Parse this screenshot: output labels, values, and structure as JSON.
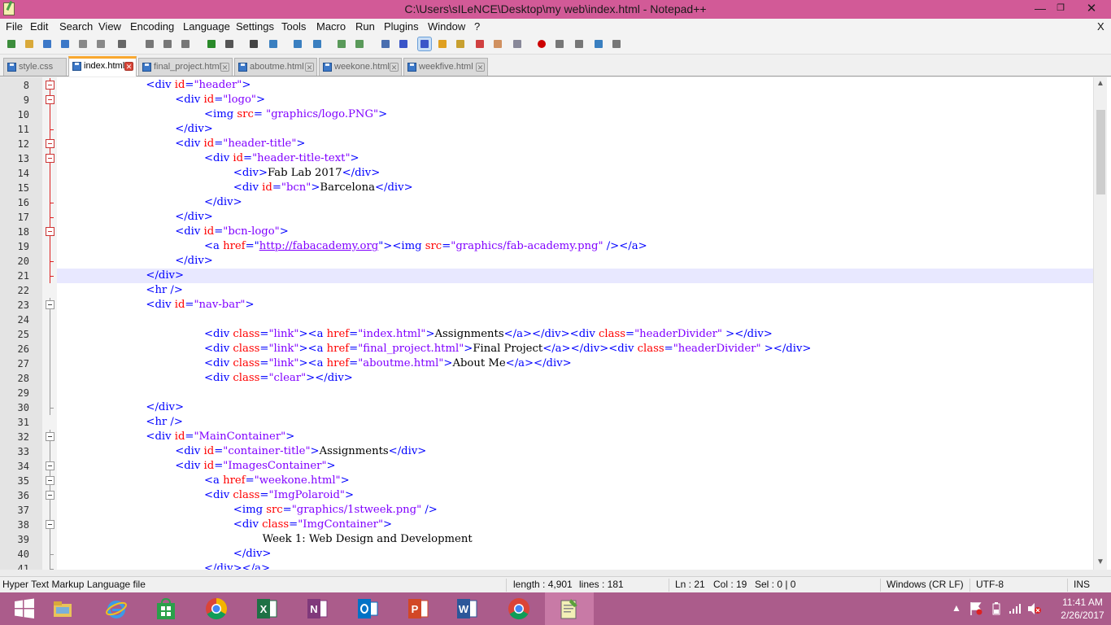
{
  "window": {
    "title": "C:\\Users\\sILeNCE\\Desktop\\my web\\index.html - Notepad++"
  },
  "menubar": {
    "items": [
      "File",
      "Edit",
      "Search",
      "View",
      "Encoding",
      "Language",
      "Settings",
      "Tools",
      "Macro",
      "Run",
      "Plugins",
      "Window",
      "?"
    ],
    "close": "X"
  },
  "toolbar": {
    "icons": [
      "new-file-icon",
      "open-file-icon",
      "save-icon",
      "save-all-icon",
      "close-icon",
      "close-all-icon",
      "print-icon",
      "cut-icon",
      "copy-icon",
      "paste-icon",
      "undo-icon",
      "redo-icon",
      "find-icon",
      "replace-icon",
      "zoom-in-icon",
      "zoom-out-icon",
      "sync-vertical-icon",
      "sync-horizontal-icon",
      "word-wrap-icon",
      "show-all-characters-icon",
      "indent-guide-icon",
      "user-defined-language-icon",
      "document-map-icon",
      "function-list-icon",
      "folder-workspace-icon",
      "monitoring-icon",
      "record-macro-icon",
      "stop-macro-icon",
      "play-macro-icon",
      "run-macro-multiple-icon",
      "save-macro-icon"
    ]
  },
  "tabs": [
    {
      "label": "style.css",
      "active": false
    },
    {
      "label": "index.html",
      "active": true
    },
    {
      "label": "final_project.html",
      "active": false
    },
    {
      "label": "aboutme.html",
      "active": false
    },
    {
      "label": "weekone.html",
      "active": false
    },
    {
      "label": "weekfive.html",
      "active": false
    }
  ],
  "editor": {
    "current_line": 21,
    "lines": [
      {
        "n": 8,
        "indent": 3,
        "tokens": [
          [
            "t",
            "<div "
          ],
          [
            "a",
            "id"
          ],
          [
            "t",
            "="
          ],
          [
            "v",
            "\"header\""
          ],
          [
            "t",
            ">"
          ]
        ],
        "fold": "open-red"
      },
      {
        "n": 9,
        "indent": 4,
        "tokens": [
          [
            "t",
            "<div "
          ],
          [
            "a",
            "id"
          ],
          [
            "t",
            "="
          ],
          [
            "v",
            "\"logo\""
          ],
          [
            "t",
            ">"
          ]
        ],
        "fold": "open-red"
      },
      {
        "n": 10,
        "indent": 5,
        "tokens": [
          [
            "t",
            "<img "
          ],
          [
            "a",
            "src"
          ],
          [
            "t",
            "= "
          ],
          [
            "v",
            "\"graphics/logo.PNG\""
          ],
          [
            "t",
            ">"
          ]
        ],
        "fold": "line"
      },
      {
        "n": 11,
        "indent": 4,
        "tokens": [
          [
            "t",
            "</div>"
          ]
        ],
        "fold": "end"
      },
      {
        "n": 12,
        "indent": 4,
        "tokens": [
          [
            "t",
            "<div "
          ],
          [
            "a",
            "id"
          ],
          [
            "t",
            "="
          ],
          [
            "v",
            "\"header-title\""
          ],
          [
            "t",
            ">"
          ]
        ],
        "fold": "open-red"
      },
      {
        "n": 13,
        "indent": 5,
        "tokens": [
          [
            "t",
            "<div "
          ],
          [
            "a",
            "id"
          ],
          [
            "t",
            "="
          ],
          [
            "v",
            "\"header-title-text\""
          ],
          [
            "t",
            ">"
          ]
        ],
        "fold": "open-red"
      },
      {
        "n": 14,
        "indent": 6,
        "tokens": [
          [
            "t",
            "<div>"
          ],
          [
            "x",
            "Fab Lab 2017"
          ],
          [
            "t",
            "</div>"
          ]
        ],
        "fold": "line"
      },
      {
        "n": 15,
        "indent": 6,
        "tokens": [
          [
            "t",
            "<div "
          ],
          [
            "a",
            "id"
          ],
          [
            "t",
            "="
          ],
          [
            "v",
            "\"bcn\""
          ],
          [
            "t",
            ">"
          ],
          [
            "x",
            "Barcelona"
          ],
          [
            "t",
            "</div>"
          ]
        ],
        "fold": "line"
      },
      {
        "n": 16,
        "indent": 5,
        "tokens": [
          [
            "t",
            "</div>"
          ]
        ],
        "fold": "end"
      },
      {
        "n": 17,
        "indent": 4,
        "tokens": [
          [
            "t",
            "</div>"
          ]
        ],
        "fold": "end"
      },
      {
        "n": 18,
        "indent": 4,
        "tokens": [
          [
            "t",
            "<div "
          ],
          [
            "a",
            "id"
          ],
          [
            "t",
            "="
          ],
          [
            "v",
            "\"bcn-logo\""
          ],
          [
            "t",
            ">"
          ]
        ],
        "fold": "open-red"
      },
      {
        "n": 19,
        "indent": 5,
        "tokens": [
          [
            "t",
            "<a "
          ],
          [
            "a",
            "href"
          ],
          [
            "t",
            "=\""
          ],
          [
            "u",
            "http://fabacademy.org"
          ],
          [
            "t",
            "\">"
          ],
          [
            "t",
            "<img "
          ],
          [
            "a",
            "src"
          ],
          [
            "t",
            "="
          ],
          [
            "v",
            "\"graphics/fab-academy.png\""
          ],
          [
            "t",
            " /></a>"
          ]
        ],
        "fold": "line"
      },
      {
        "n": 20,
        "indent": 4,
        "tokens": [
          [
            "t",
            "</div>"
          ]
        ],
        "fold": "end"
      },
      {
        "n": 21,
        "indent": 3,
        "tokens": [
          [
            "t",
            "</div>"
          ]
        ],
        "fold": "end"
      },
      {
        "n": 22,
        "indent": 3,
        "tokens": [
          [
            "t",
            "<hr />"
          ]
        ],
        "fold": "none"
      },
      {
        "n": 23,
        "indent": 3,
        "tokens": [
          [
            "t",
            "<div "
          ],
          [
            "a",
            "id"
          ],
          [
            "t",
            "="
          ],
          [
            "v",
            "\"nav-bar\""
          ],
          [
            "t",
            ">"
          ]
        ],
        "fold": "open"
      },
      {
        "n": 24,
        "indent": 0,
        "tokens": [],
        "fold": "line-grey"
      },
      {
        "n": 25,
        "indent": 5,
        "tokens": [
          [
            "t",
            "<div "
          ],
          [
            "a",
            "class"
          ],
          [
            "t",
            "="
          ],
          [
            "v",
            "\"link\""
          ],
          [
            "t",
            "><a "
          ],
          [
            "a",
            "href"
          ],
          [
            "t",
            "="
          ],
          [
            "v",
            "\"index.html\""
          ],
          [
            "t",
            ">"
          ],
          [
            "x",
            "Assignments"
          ],
          [
            "t",
            "</a></div><div "
          ],
          [
            "a",
            "class"
          ],
          [
            "t",
            "="
          ],
          [
            "v",
            "\"headerDivider\""
          ],
          [
            "t",
            " ></div>"
          ]
        ],
        "fold": "line-grey"
      },
      {
        "n": 26,
        "indent": 5,
        "tokens": [
          [
            "t",
            "<div "
          ],
          [
            "a",
            "class"
          ],
          [
            "t",
            "="
          ],
          [
            "v",
            "\"link\""
          ],
          [
            "t",
            "><a "
          ],
          [
            "a",
            "href"
          ],
          [
            "t",
            "="
          ],
          [
            "v",
            "\"final_project.html\""
          ],
          [
            "t",
            ">"
          ],
          [
            "x",
            "Final Project"
          ],
          [
            "t",
            "</a></div><div "
          ],
          [
            "a",
            "class"
          ],
          [
            "t",
            "="
          ],
          [
            "v",
            "\"headerDivider\""
          ],
          [
            "t",
            " ></div>"
          ]
        ],
        "fold": "line-grey"
      },
      {
        "n": 27,
        "indent": 5,
        "tokens": [
          [
            "t",
            "<div "
          ],
          [
            "a",
            "class"
          ],
          [
            "t",
            "="
          ],
          [
            "v",
            "\"link\""
          ],
          [
            "t",
            "><a "
          ],
          [
            "a",
            "href"
          ],
          [
            "t",
            "="
          ],
          [
            "v",
            "\"aboutme.html\""
          ],
          [
            "t",
            ">"
          ],
          [
            "x",
            "About Me"
          ],
          [
            "t",
            "</a></div>"
          ]
        ],
        "fold": "line-grey"
      },
      {
        "n": 28,
        "indent": 5,
        "tokens": [
          [
            "t",
            "<div "
          ],
          [
            "a",
            "class"
          ],
          [
            "t",
            "="
          ],
          [
            "v",
            "\"clear\""
          ],
          [
            "t",
            "></div>"
          ]
        ],
        "fold": "line-grey"
      },
      {
        "n": 29,
        "indent": 0,
        "tokens": [],
        "fold": "line-grey"
      },
      {
        "n": 30,
        "indent": 3,
        "tokens": [
          [
            "t",
            "</div>"
          ]
        ],
        "fold": "end-grey"
      },
      {
        "n": 31,
        "indent": 3,
        "tokens": [
          [
            "t",
            "<hr />"
          ]
        ],
        "fold": "none"
      },
      {
        "n": 32,
        "indent": 3,
        "tokens": [
          [
            "t",
            "<div "
          ],
          [
            "a",
            "id"
          ],
          [
            "t",
            "="
          ],
          [
            "v",
            "\"MainContainer\""
          ],
          [
            "t",
            ">"
          ]
        ],
        "fold": "open"
      },
      {
        "n": 33,
        "indent": 4,
        "tokens": [
          [
            "t",
            "<div "
          ],
          [
            "a",
            "id"
          ],
          [
            "t",
            "="
          ],
          [
            "v",
            "\"container-title\""
          ],
          [
            "t",
            ">"
          ],
          [
            "x",
            "Assignments"
          ],
          [
            "t",
            "</div>"
          ]
        ],
        "fold": "line-grey"
      },
      {
        "n": 34,
        "indent": 4,
        "tokens": [
          [
            "t",
            "<div "
          ],
          [
            "a",
            "id"
          ],
          [
            "t",
            "="
          ],
          [
            "v",
            "\"ImagesContainer\""
          ],
          [
            "t",
            ">"
          ]
        ],
        "fold": "open"
      },
      {
        "n": 35,
        "indent": 5,
        "tokens": [
          [
            "t",
            "<a "
          ],
          [
            "a",
            "href"
          ],
          [
            "t",
            "="
          ],
          [
            "v",
            "\"weekone.html\""
          ],
          [
            "t",
            ">"
          ]
        ],
        "fold": "open"
      },
      {
        "n": 36,
        "indent": 5,
        "tokens": [
          [
            "t",
            "<div "
          ],
          [
            "a",
            "class"
          ],
          [
            "t",
            "="
          ],
          [
            "v",
            "\"ImgPolaroid\""
          ],
          [
            "t",
            ">"
          ]
        ],
        "fold": "open"
      },
      {
        "n": 37,
        "indent": 6,
        "tokens": [
          [
            "t",
            "<img "
          ],
          [
            "a",
            "src"
          ],
          [
            "t",
            "="
          ],
          [
            "v",
            "\"graphics/1stweek.png\""
          ],
          [
            "t",
            " />"
          ]
        ],
        "fold": "line-grey"
      },
      {
        "n": 38,
        "indent": 6,
        "tokens": [
          [
            "t",
            "<div "
          ],
          [
            "a",
            "class"
          ],
          [
            "t",
            "="
          ],
          [
            "v",
            "\"ImgContainer\""
          ],
          [
            "t",
            ">"
          ]
        ],
        "fold": "open"
      },
      {
        "n": 39,
        "indent": 7,
        "tokens": [
          [
            "x",
            "Week 1: Web Design and Development"
          ]
        ],
        "fold": "line-grey"
      },
      {
        "n": 40,
        "indent": 6,
        "tokens": [
          [
            "t",
            "</div>"
          ]
        ],
        "fold": "end-grey"
      },
      {
        "n": 41,
        "indent": 5,
        "tokens": [
          [
            "t",
            "</div></a>"
          ]
        ],
        "fold": "end-grey"
      }
    ]
  },
  "statusbar": {
    "filetype": "Hyper Text Markup Language file",
    "length": "length : 4,901",
    "lines": "lines : 181",
    "ln": "Ln : 21",
    "col": "Col : 19",
    "sel": "Sel : 0 | 0",
    "eol": "Windows (CR LF)",
    "encoding": "UTF-8",
    "mode": "INS"
  },
  "taskbar": {
    "apps": [
      "start-icon",
      "file-explorer-icon",
      "internet-explorer-icon",
      "store-icon",
      "chrome-icon",
      "excel-icon",
      "onenote-icon",
      "outlook-icon",
      "powerpoint-icon",
      "word-icon",
      "chrome-icon",
      "notepad-plus-plus-icon"
    ],
    "clock_time": "11:41 AM",
    "clock_date": "2/26/2017"
  },
  "colors": {
    "titlebar": "#d25a97",
    "taskbar": "#ab5c8b",
    "tag": "#0000ff",
    "attr": "#ff0000",
    "value": "#8000ff",
    "current_line": "#e8e8ff",
    "active_tab_accent": "#f9a82f"
  }
}
